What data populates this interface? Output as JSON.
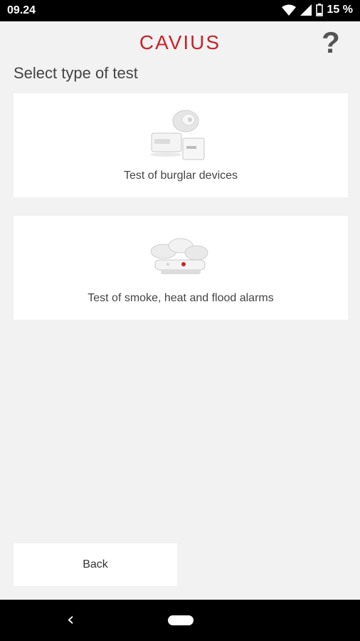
{
  "status_bar": {
    "time": "09.24",
    "battery": "15 %"
  },
  "header": {
    "logo_text": "CAVIUS",
    "help_label": "?"
  },
  "page": {
    "title": "Select type of test"
  },
  "options": [
    {
      "label": "Test of burglar devices"
    },
    {
      "label": "Test of smoke, heat and flood alarms"
    }
  ],
  "back_button": {
    "label": "Back"
  },
  "nav": {
    "back_glyph": "‹"
  },
  "colors": {
    "brand": "#c6242a",
    "background": "#f2f2f2",
    "card": "#ffffff"
  }
}
